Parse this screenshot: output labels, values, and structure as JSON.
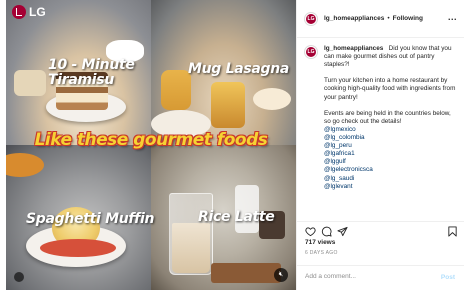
{
  "media": {
    "brand": "LG",
    "dishes": [
      "10 - Minute\nTiramisu",
      "Mug Lasagna",
      "Spaghetti Muffin",
      "Rice Latte"
    ],
    "headline": "Like these gourmet foods"
  },
  "header": {
    "username": "lg_homeappliances",
    "separator": "•",
    "follow_label": "Following",
    "more": "..."
  },
  "caption": {
    "username": "lg_homeappliances",
    "intro": "Did you know that you can make gourmet dishes out of pantry staples?!",
    "body": "Turn your kitchen into a home restaurant by cooking high-quality food with ingredients from your pantry!",
    "events": "Events are being held in the countries below, so go check out the details!",
    "tags": [
      "@lgmexico",
      "@lg_colombia",
      "@lg_peru",
      "@lgafrica1",
      "@lggulf",
      "@lgelectronicsca",
      "@lg_saudi",
      "@lglevant"
    ]
  },
  "stats": {
    "likes": "717 views",
    "date": "6 DAYS AGO"
  },
  "comment": {
    "placeholder": "Add a comment...",
    "post_label": "Post"
  },
  "colors": {
    "brand": "#a50034",
    "headline_fill": "#f6d233",
    "headline_outline": "#c8382a",
    "link": "#00376b",
    "post_disabled": "#b2dffc"
  },
  "icons": [
    "heart-icon",
    "comment-icon",
    "share-icon",
    "bookmark-icon",
    "mute-icon"
  ]
}
